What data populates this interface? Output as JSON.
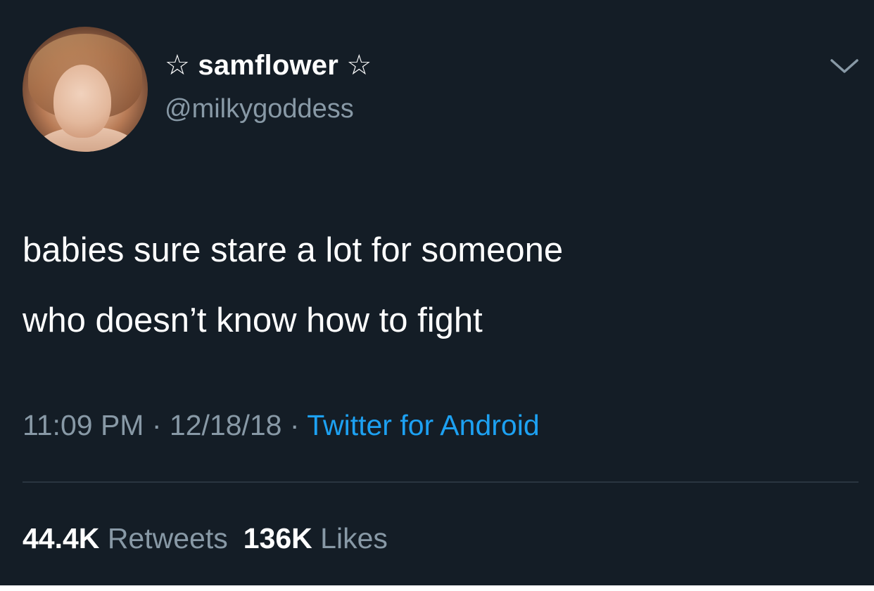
{
  "user": {
    "display_name": "☆ samflower ☆",
    "handle": "@milkygoddess"
  },
  "tweet": {
    "lines": [
      "babies sure stare a lot for someone",
      "who doesn’t know how to fight"
    ]
  },
  "meta": {
    "time": "11:09 PM",
    "separator": " · ",
    "date": "12/18/18",
    "source": "Twitter for Android"
  },
  "stats": {
    "retweets_count": "44.4K",
    "retweets_label": "Retweets",
    "likes_count": "136K",
    "likes_label": "Likes"
  },
  "icons": {
    "menu": "chevron-down-icon"
  },
  "colors": {
    "background": "#141d26",
    "primary_text": "#ffffff",
    "secondary_text": "#8899a6",
    "link": "#1da1f2"
  }
}
